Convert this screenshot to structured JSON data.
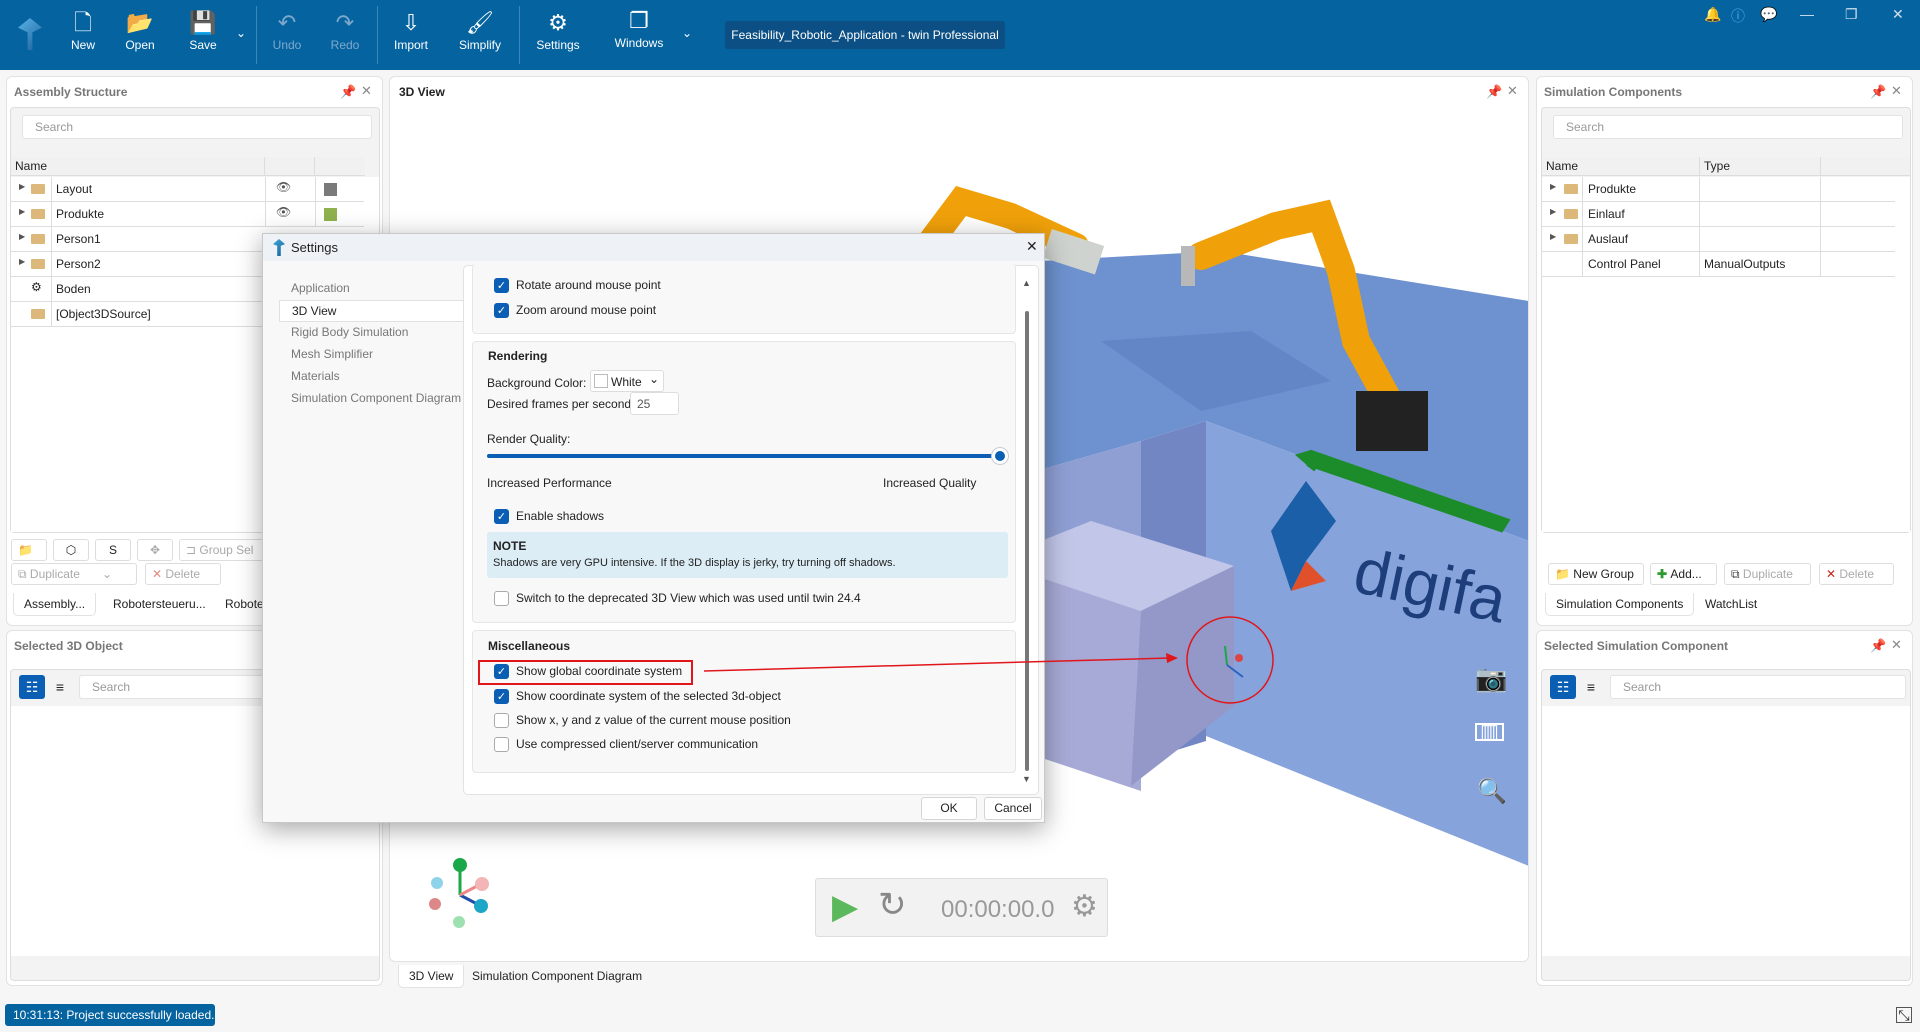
{
  "toolbar": {
    "new": "New",
    "open": "Open",
    "save": "Save",
    "undo": "Undo",
    "redo": "Redo",
    "import": "Import",
    "simplify": "Simplify",
    "settings": "Settings",
    "windows": "Windows",
    "window_title": "Feasibility_Robotic_Application - twin Professional"
  },
  "assembly": {
    "title": "Assembly Structure",
    "search_placeholder": "Search",
    "col_name": "Name",
    "rows": [
      {
        "label": "Layout",
        "color": "#7a7a7a"
      },
      {
        "label": "Produkte",
        "color": "#8fb14e"
      },
      {
        "label": "Person1"
      },
      {
        "label": "Person2"
      },
      {
        "label": "Boden"
      },
      {
        "label": "[Object3DSource]"
      }
    ],
    "group_sel": "Group Sel",
    "duplicate": "Duplicate",
    "delete": "Delete",
    "tabs": [
      "Assembly...",
      "Robotersteueru...",
      "Roboters"
    ]
  },
  "selected3d": {
    "title": "Selected 3D Object",
    "search_placeholder": "Search"
  },
  "view3d": {
    "title": "3D View",
    "time": "00:00:00.0",
    "tabs": [
      "3D View",
      "Simulation Component Diagram"
    ],
    "logo_text": "digifa"
  },
  "simcomp": {
    "title": "Simulation Components",
    "search_placeholder": "Search",
    "col_name": "Name",
    "col_type": "Type",
    "rows": [
      {
        "name": "Produkte",
        "type": ""
      },
      {
        "name": "Einlauf",
        "type": ""
      },
      {
        "name": "Auslauf",
        "type": ""
      },
      {
        "name": "Control Panel",
        "type": "ManualOutputs"
      }
    ],
    "new_group": "New Group",
    "add": "Add...",
    "duplicate": "Duplicate",
    "delete": "Delete",
    "tabs": [
      "Simulation Components",
      "WatchList"
    ]
  },
  "selsim": {
    "title": "Selected Simulation Component",
    "search_placeholder": "Search"
  },
  "status": {
    "message": "10:31:13: Project successfully loaded."
  },
  "dialog": {
    "title": "Settings",
    "nav": [
      "Application",
      "3D View",
      "Rigid Body Simulation",
      "Mesh Simplifier",
      "Materials",
      "Simulation Component Diagram"
    ],
    "rotate": "Rotate around mouse point",
    "zoom": "Zoom around mouse point",
    "rendering": "Rendering",
    "bg_label": "Background Color:",
    "bg_value": "White",
    "fps_label": "Desired frames per second:",
    "fps_value": "25",
    "quality_label": "Render Quality:",
    "quality_level": 1.0,
    "quality_min": "Increased Performance",
    "quality_max": "Increased Quality",
    "shadows": "Enable shadows",
    "note_title": "NOTE",
    "note_text": "Shadows are very GPU intensive. If the 3D display is jerky, try turning off shadows.",
    "deprecated": "Switch to the deprecated 3D View which was used until twin 24.4",
    "misc": "Miscellaneous",
    "global_cs": "Show global coordinate system",
    "object_cs": "Show coordinate system of the selected 3d-object",
    "xyz": "Show x, y and z value of the current mouse position",
    "compressed": "Use compressed client/server communication",
    "ok": "OK",
    "cancel": "Cancel"
  },
  "colors": {
    "accent": "#0563a0",
    "checkbox": "#0a5fb4",
    "annotation": "#e0161b"
  }
}
